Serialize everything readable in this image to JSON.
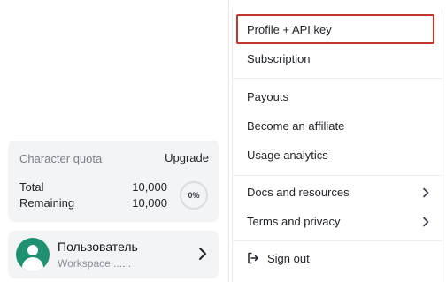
{
  "quota": {
    "title": "Character quota",
    "upgrade_label": "Upgrade",
    "total_label": "Total",
    "total_value": "10,000",
    "remaining_label": "Remaining",
    "remaining_value": "10,000",
    "percent_label": "0%"
  },
  "user": {
    "name": "Пользователь",
    "workspace": "Workspace ......"
  },
  "menu": {
    "items": [
      {
        "label": "Profile + API key",
        "highlighted": true
      },
      {
        "label": "Subscription"
      },
      {
        "label": "Payouts"
      },
      {
        "label": "Become an affiliate"
      },
      {
        "label": "Usage analytics"
      },
      {
        "label": "Docs and resources",
        "has_submenu": true
      },
      {
        "label": "Terms and privacy",
        "has_submenu": true
      },
      {
        "label": "Sign out",
        "icon": "sign-out-icon"
      }
    ]
  },
  "colors": {
    "highlight_border": "#c4372b",
    "avatar_bg": "#1f9170",
    "card_bg": "#f3f4f6"
  }
}
